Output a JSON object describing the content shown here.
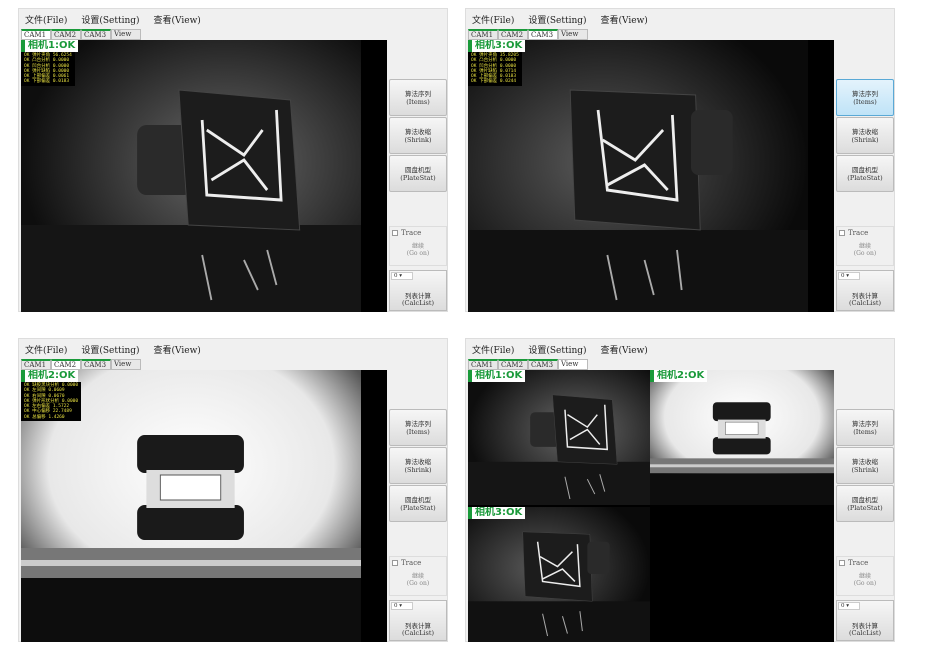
{
  "menu": {
    "file": "文件(File)",
    "setting": "设置(Setting)",
    "view": "查看(View)"
  },
  "tabs": [
    "CAM1",
    "CAM2",
    "CAM3",
    "View"
  ],
  "buttons": {
    "items": {
      "cn": "算法序列",
      "en": "(Items)"
    },
    "shrink": {
      "cn": "算法收缩",
      "en": "(Shrink)"
    },
    "platestat": {
      "cn": "圆盘机型",
      "en": "(PlateStat)"
    },
    "trace": "Trace",
    "goon": {
      "cn": "继续",
      "en": "(Go on)"
    },
    "calc": {
      "cn": "列表计算",
      "en": "(CalcList)"
    },
    "select_value": "0 ▾"
  },
  "panels": [
    {
      "active_tab": 0,
      "items_selected": false,
      "cams": [
        {
          "label": "相机1:OK",
          "scene": "c1",
          "stats": [
            "OK 弹片夹角 56.6254",
            "OK 凸台分析 0.0000",
            "OK 凹台分析 0.0000",
            "OK 弹片缺陷 0.0000",
            "OK 上部偏差 0.0061",
            "OK 下部偏差 0.0183"
          ]
        }
      ]
    },
    {
      "active_tab": 2,
      "items_selected": true,
      "cams": [
        {
          "label": "相机3:OK",
          "scene": "c3",
          "stats": [
            "OK 弹片夹角 35.8205",
            "OK 凸台分析 0.0000",
            "OK 凹台分析 0.0000",
            "OK 弹片缺陷 0.0714",
            "OK 上部偏差 0.0183",
            "OK 下部偏差 0.0244"
          ]
        }
      ]
    },
    {
      "active_tab": 1,
      "items_selected": false,
      "cams": [
        {
          "label": "相机2:OK",
          "scene": "c2",
          "stats": [
            "OK 缺胶黑块分析 0.0000",
            "OK 左间隙 0.0609",
            "OK 右间隙 0.0670",
            "OK 弹片形状分析 0.0000",
            "OK 左右偏差 1.5722",
            "OK 中心偏移 22.7489",
            "OK 总偏移 1.4260"
          ]
        }
      ]
    },
    {
      "active_tab": 3,
      "items_selected": false,
      "cams": [
        {
          "label": "相机1:OK",
          "scene": "c1"
        },
        {
          "label": "相机2:OK",
          "scene": "c2"
        },
        {
          "label": "相机3:OK",
          "scene": "c3"
        }
      ]
    }
  ]
}
